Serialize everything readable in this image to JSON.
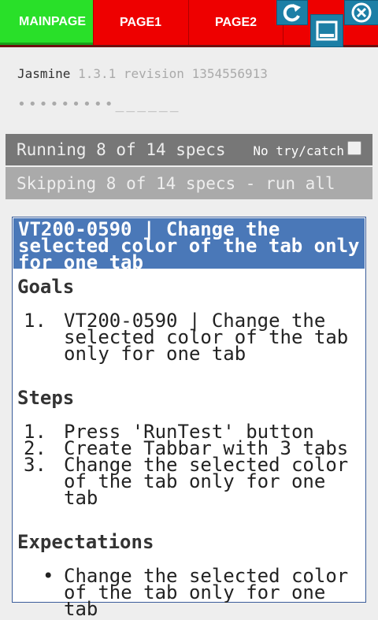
{
  "tabs": [
    {
      "label": "MAINPAGE"
    },
    {
      "label": "PAGE1"
    },
    {
      "label": "PAGE2"
    }
  ],
  "controls": {
    "refresh_icon": "refresh-icon",
    "minimize_icon": "minimize-icon",
    "close_icon": "close-icon"
  },
  "jasmine": {
    "name": "Jasmine",
    "version": "1.3.1 revision 1354556913",
    "dots": "•••••••••______"
  },
  "status": {
    "running": "Running 8 of 14 specs",
    "trycatch_label": "No try/catch",
    "skipping": "Skipping 8 of 14 specs - run all"
  },
  "spec": {
    "title": "VT200-0590 | Change the selected color of the tab only for one tab",
    "goals_heading": "Goals",
    "goals": [
      "VT200-0590 | Change the selected color of the tab only for one tab"
    ],
    "steps_heading": "Steps",
    "steps": [
      "Press 'RunTest' button",
      "Create Tabbar with 3 tabs",
      "Change the selected color of the tab only for one tab"
    ],
    "expectations_heading": "Expectations",
    "expectations": [
      "Change the selected color of the tab only for one tab"
    ]
  },
  "colors": {
    "tabbar": "#ee0000",
    "active_tab": "#29e029",
    "control_button": "#1c7fa6",
    "spec_header": "#4a78b8"
  }
}
